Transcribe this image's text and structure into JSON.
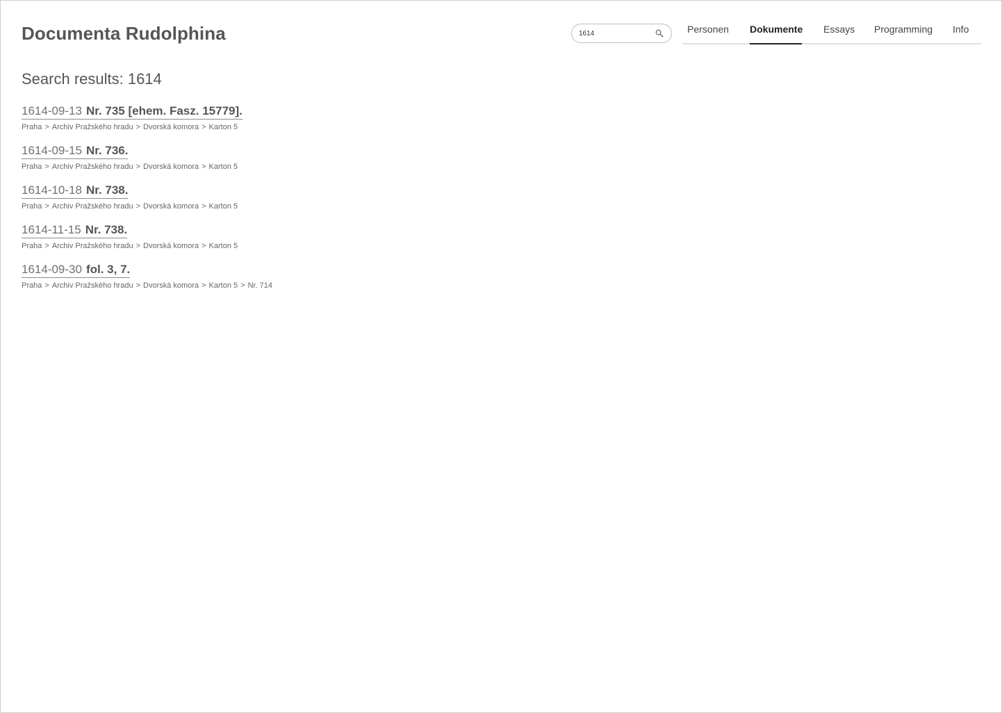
{
  "site": {
    "title": "Documenta Rudolphina"
  },
  "search": {
    "value": "1614",
    "placeholder": ""
  },
  "nav": {
    "items": [
      {
        "label": "Personen"
      },
      {
        "label": "Dokumente"
      },
      {
        "label": "Essays"
      },
      {
        "label": "Programming"
      },
      {
        "label": "Info"
      }
    ],
    "active": "Dokumente"
  },
  "results": {
    "heading": "Search results: 1614",
    "items": [
      {
        "date": "1614-09-13",
        "title": "Nr. 735 [ehem. Fasz. 15779].",
        "path": [
          "Praha",
          "Archiv Pražského hradu",
          "Dvorská komora",
          "Karton 5"
        ]
      },
      {
        "date": "1614-09-15",
        "title": "Nr. 736.",
        "path": [
          "Praha",
          "Archiv Pražského hradu",
          "Dvorská komora",
          "Karton 5"
        ]
      },
      {
        "date": "1614-10-18",
        "title": "Nr. 738.",
        "path": [
          "Praha",
          "Archiv Pražského hradu",
          "Dvorská komora",
          "Karton 5"
        ]
      },
      {
        "date": "1614-11-15",
        "title": "Nr. 738.",
        "path": [
          "Praha",
          "Archiv Pražského hradu",
          "Dvorská komora",
          "Karton 5"
        ]
      },
      {
        "date": "1614-09-30",
        "title": "fol. 3, 7.",
        "path": [
          "Praha",
          "Archiv Pražského hradu",
          "Dvorská komora",
          "Karton 5",
          "Nr. 714"
        ]
      }
    ]
  },
  "breadcrumb_separator": ">",
  "colors": {
    "text": "#555555",
    "active_nav": "#222222",
    "border": "#bdbdbd"
  }
}
